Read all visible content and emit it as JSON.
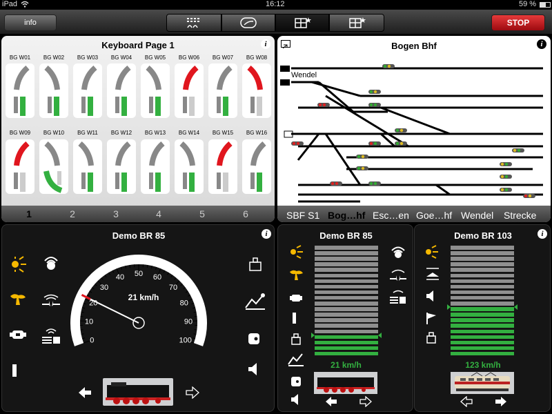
{
  "status": {
    "device": "iPad",
    "time": "16:12",
    "battery": "59 %"
  },
  "toolbar": {
    "info_label": "info",
    "stop_label": "STOP"
  },
  "keyboard": {
    "title": "Keyboard Page 1",
    "switches": [
      {
        "label": "BG W01",
        "state": "green"
      },
      {
        "label": "BG W02",
        "state": "green"
      },
      {
        "label": "BG W03",
        "state": "green"
      },
      {
        "label": "BG W04",
        "state": "green"
      },
      {
        "label": "BG W05",
        "state": "green"
      },
      {
        "label": "BG W06",
        "state": "red"
      },
      {
        "label": "BG W07",
        "state": "green"
      },
      {
        "label": "BG W08",
        "state": "red"
      },
      {
        "label": "BG W09",
        "state": "red"
      },
      {
        "label": "BG W10",
        "state": "green"
      },
      {
        "label": "BG W11",
        "state": "green"
      },
      {
        "label": "BG W12",
        "state": "green"
      },
      {
        "label": "BG W13",
        "state": "green"
      },
      {
        "label": "BG W14",
        "state": "green"
      },
      {
        "label": "BG W15",
        "state": "red"
      },
      {
        "label": "BG W16",
        "state": "green"
      }
    ],
    "pages": [
      "1",
      "2",
      "3",
      "4",
      "5",
      "6"
    ],
    "active_page": "1"
  },
  "track": {
    "title": "Bogen Bhf",
    "wendel_label": "Wendel",
    "tabs": [
      "SBF S1",
      "Bog…hf",
      "Esc…en",
      "Goe…hf",
      "Wendel",
      "Strecke"
    ],
    "active_tab": "Bog…hf"
  },
  "cab_main": {
    "name": "Demo BR 85",
    "speed_label": "21 km/h",
    "speed": 21,
    "scale": [
      "0",
      "10",
      "20",
      "30",
      "40",
      "50",
      "60",
      "70",
      "80",
      "90",
      "100"
    ]
  },
  "cab_mid": {
    "name": "Demo BR 85",
    "speed_label": "21 km/h",
    "level": 0.18
  },
  "cab_right": {
    "name": "Demo BR 103",
    "speed_label": "123 km/h",
    "level": 0.45
  },
  "colors": {
    "green": "#33b040",
    "red": "#e0161e",
    "stop": "#c8101a",
    "bar_gray": "#8f8f8f"
  }
}
